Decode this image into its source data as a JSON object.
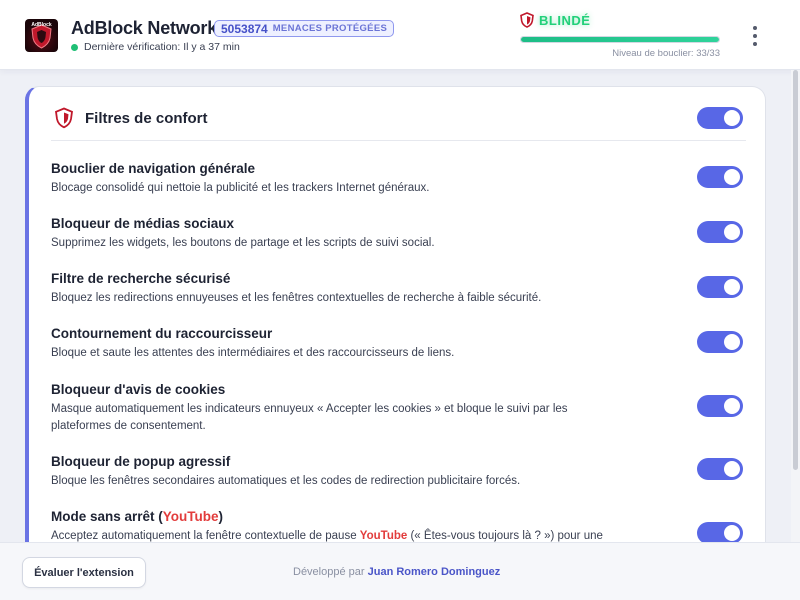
{
  "header": {
    "app_title": "AdBlock Network",
    "threat_count": "5053874",
    "threat_label": "MENACES PROTÉGÉES",
    "last_check": "Dernière vérification: Il y a 37 min",
    "status_text": "BLINDÉ",
    "shield_level_text": "Niveau de bouclier: 33/33",
    "shield_level_fraction": 1.0,
    "logo_text": "AdBlock"
  },
  "card": {
    "title": "Filtres de confort",
    "master_toggle_on": true,
    "filters": [
      {
        "name": "Bouclier de navigation générale",
        "desc": "Blocage consolidé qui nettoie la publicité et les trackers Internet généraux.",
        "on": true
      },
      {
        "name": "Bloqueur de médias sociaux",
        "desc": "Supprimez les widgets, les boutons de partage et les scripts de suivi social.",
        "on": true
      },
      {
        "name": "Filtre de recherche sécurisé",
        "desc": "Bloquez les redirections ennuyeuses et les fenêtres contextuelles de recherche à faible sécurité.",
        "on": true
      },
      {
        "name": "Contournement du raccourcisseur",
        "desc": "Bloque et saute les attentes des intermédiaires et des raccourcisseurs de liens.",
        "on": true
      },
      {
        "name": "Bloqueur d'avis de cookies",
        "desc": "Masque automatiquement les indicateurs ennuyeux « Accepter les cookies » et bloque le suivi par les plateformes de consentement.",
        "on": true
      },
      {
        "name": "Bloqueur de popup agressif",
        "desc": "Bloque les fenêtres secondaires automatiques et les codes de redirection publicitaire forcés.",
        "on": true
      },
      {
        "name_prefix": "Mode sans arrêt (",
        "name_yt": "YouTube",
        "name_suffix": ")",
        "desc_prefix": "Acceptez automatiquement la fenêtre contextuelle de pause ",
        "desc_yt": "YouTube",
        "desc_suffix": " (« Êtes-vous toujours là ? ») pour une",
        "on": true
      }
    ]
  },
  "footer": {
    "evaluate_label": "Évaluer l'extension",
    "credits_prefix": "Développé par ",
    "credits_author": "Juan Romero Dominguez"
  },
  "colors": {
    "accent": "#5867e6",
    "status_green": "#22d07a",
    "youtube_red": "#e23c3c"
  },
  "icons": {
    "logo": "adblock-logo",
    "status": "shield-icon",
    "card": "shield-icon",
    "menu": "kebab-menu-icon"
  }
}
